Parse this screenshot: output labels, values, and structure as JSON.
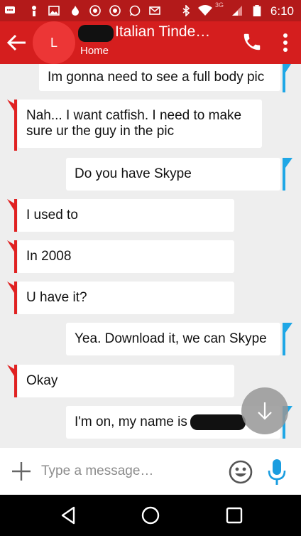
{
  "status_bar": {
    "time": "6:10",
    "network": "3G",
    "icons": [
      "message-icon",
      "person-icon",
      "image-icon",
      "flame-icon",
      "chrome-icon",
      "chrome-icon",
      "whatsapp-icon",
      "gmail-icon",
      "bluetooth-icon",
      "wifi-icon",
      "signal-icon",
      "battery-icon"
    ]
  },
  "header": {
    "avatar_letter": "L",
    "title": "Italian Tinde…",
    "subtitle": "Home"
  },
  "messages": [
    {
      "side": "sent",
      "text": "Im gonna need to see a full body pic"
    },
    {
      "side": "received",
      "text": "Nah... I want catfish. I need to make sure ur the guy in the pic"
    },
    {
      "side": "sent",
      "text": "Do you have Skype"
    },
    {
      "side": "received",
      "text": "I used to"
    },
    {
      "side": "received",
      "text": "In 2008"
    },
    {
      "side": "received",
      "text": "U have it?"
    },
    {
      "side": "sent",
      "text": "Yea. Download it, we can Skype"
    },
    {
      "side": "received",
      "text": "Okay"
    },
    {
      "side": "sent",
      "text": "I'm on, my name is"
    }
  ],
  "composer": {
    "placeholder": "Type a message…"
  },
  "colors": {
    "status_bar": "#b31a1a",
    "app_bar": "#d51e1e",
    "avatar": "#ec3636",
    "received_flag": "#e02222",
    "sent_flag": "#1fa7e6",
    "mic": "#1a9de0",
    "chat_bg": "#eeeeee"
  }
}
